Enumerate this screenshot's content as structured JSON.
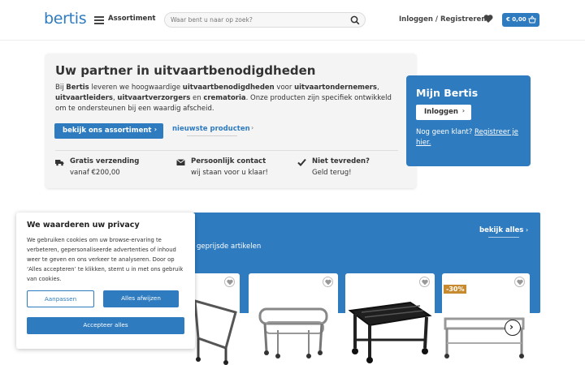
{
  "header": {
    "logo": "bertis",
    "menu_label": "Assortiment",
    "search_placeholder": "Waar bent u naar op zoek?",
    "login_label": "Inloggen / Registreren",
    "cart_amount": "€ 0,00"
  },
  "hero": {
    "title": "Uw partner in uitvaartbenodigdheden",
    "body": [
      {
        "t": "Bij ",
        "b": false
      },
      {
        "t": "Bertis",
        "b": true
      },
      {
        "t": " leveren we hoogwaardige ",
        "b": false
      },
      {
        "t": "uitvaartbenodigdheden",
        "b": true
      },
      {
        "t": " voor ",
        "b": false
      },
      {
        "t": "uitvaartondernemers",
        "b": true
      },
      {
        "t": ", ",
        "b": false
      },
      {
        "t": "uitvaartleiders",
        "b": true
      },
      {
        "t": ", ",
        "b": false
      },
      {
        "t": "uitvaartverzorgers",
        "b": true
      },
      {
        "t": " en ",
        "b": false
      },
      {
        "t": "crematoria",
        "b": true
      },
      {
        "t": ". Onze producten zijn specifiek ontwikkeld om te ondersteunen bij een waardig afscheid.",
        "b": false
      }
    ],
    "primary_button": "bekijk ons assortiment",
    "secondary_link": "nieuwste producten",
    "features": [
      {
        "icon": "truck-icon",
        "title": "Gratis verzending",
        "sub": "vanaf €200,00"
      },
      {
        "icon": "envelope-icon",
        "title": "Persoonlijk contact",
        "sub": "wij staan voor u klaar!"
      },
      {
        "icon": "check-icon",
        "title": "Niet tevreden?",
        "sub": "Geld terug!"
      }
    ]
  },
  "account": {
    "title": "Mijn Bertis",
    "login_button": "Inloggen",
    "no_customer": "Nog geen klant? ",
    "register_link": "Registreer je hier."
  },
  "products": {
    "subtitle": "geprijsde artikelen",
    "view_all": "bekijk alles",
    "items": [
      {
        "name": "product-1",
        "badge": ""
      },
      {
        "name": "product-2",
        "badge": ""
      },
      {
        "name": "product-3",
        "badge": ""
      },
      {
        "name": "product-4",
        "badge": "-30%"
      }
    ]
  },
  "cookie": {
    "title": "We waarderen uw privacy",
    "body": "We gebruiken cookies om uw browse-ervaring te verbeteren, gepersonaliseerde advertenties of inhoud weer te geven en ons verkeer te analyseren. Door op ‘Alles accepteren’ te klikken, stemt u in met ons gebruik van cookies.",
    "customize": "Aanpassen",
    "reject": "Alles afwijzen",
    "accept": "Accepteer alles"
  },
  "colors": {
    "brand_blue": "#2e7bbf",
    "sale_badge": "#c88a2e"
  }
}
